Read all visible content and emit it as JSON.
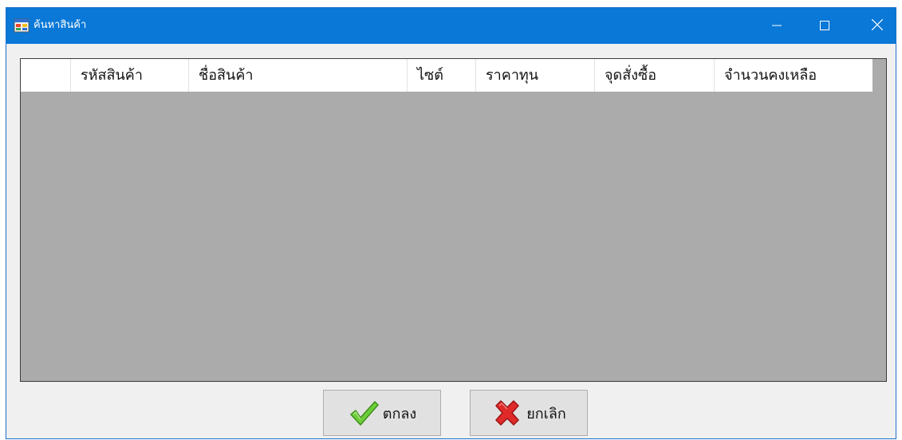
{
  "window": {
    "title": "ค้นหาสินค้า",
    "icon": "form-app-icon",
    "controls": [
      "minimize-icon",
      "maximize-icon",
      "close-icon"
    ],
    "titlebar_color": "#0a78d7"
  },
  "grid": {
    "columns": [
      "",
      "รหัสสินค้า",
      "ชื่อสินค้า",
      "ไซต์",
      "ราคาทุน",
      "จุดสั่งซื้อ",
      "จำนวนคงเหลือ"
    ],
    "rows": [],
    "background_color": "#ababab"
  },
  "buttons": {
    "ok_label": "ตกลง",
    "ok_icon": "checkmark-icon",
    "cancel_label": "ยกเลิก",
    "cancel_icon": "red-x-icon"
  }
}
